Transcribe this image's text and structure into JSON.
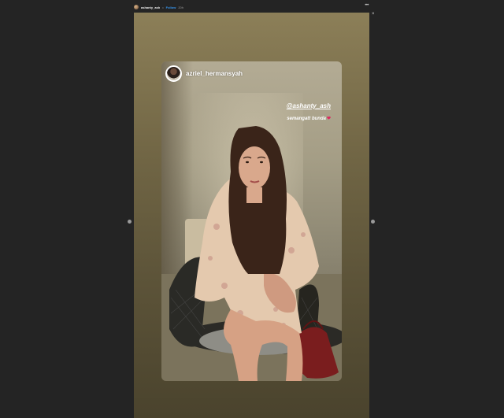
{
  "top_bar": {
    "username": "ashanty_ash",
    "separator": "•",
    "follow_label": "Follow",
    "time": "20h",
    "more_label": "•••",
    "close_label": "×"
  },
  "story": {
    "shared_post": {
      "username": "azriel_hermansyah",
      "mention": "@ashanty_ash",
      "caption": "semangatt bunda",
      "heart": "❤"
    }
  },
  "colors": {
    "background": "#242424",
    "link": "#3897f0",
    "heart": "#e0245e"
  },
  "icons": [
    "avatar",
    "more-options-icon",
    "close-icon",
    "heart-icon",
    "prev-arrow-icon",
    "next-arrow-icon"
  ]
}
